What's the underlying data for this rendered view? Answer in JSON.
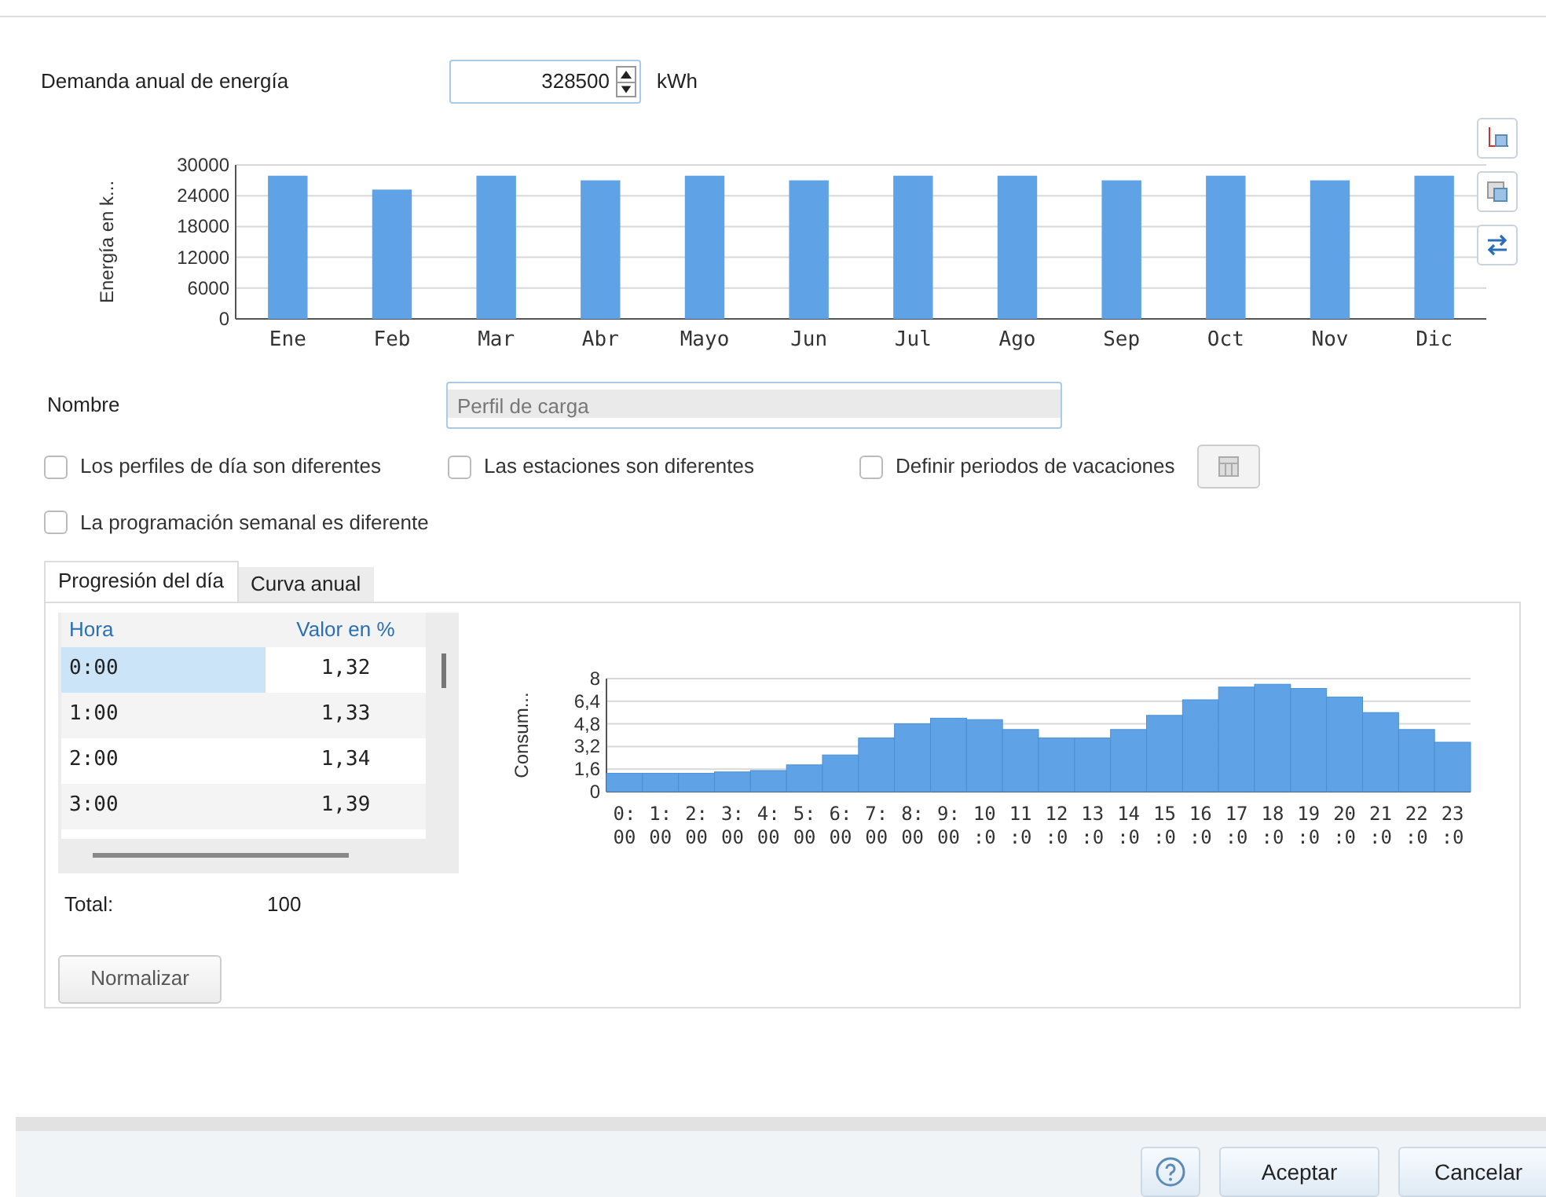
{
  "demand": {
    "label": "Demanda anual de energía",
    "value": "328500",
    "unit": "kWh"
  },
  "monthly_chart": {
    "chart_data": {
      "type": "bar",
      "ylabel": "Energía en k...",
      "categories": [
        "Ene",
        "Feb",
        "Mar",
        "Abr",
        "Mayo",
        "Jun",
        "Jul",
        "Ago",
        "Sep",
        "Oct",
        "Nov",
        "Dic"
      ],
      "grid": true,
      "series": [
        {
          "color": "#5fa3e6",
          "values": [
            27900,
            25200,
            27900,
            27000,
            27900,
            27000,
            27900,
            27900,
            27000,
            27900,
            27000,
            27900
          ]
        }
      ],
      "ylim": [
        0,
        30000
      ],
      "yticks": [
        0,
        6000,
        12000,
        18000,
        24000,
        30000
      ]
    }
  },
  "name_field": {
    "label": "Nombre",
    "placeholder": "Perfil de carga"
  },
  "options": [
    {
      "label": "Los perfiles de día son diferentes",
      "checked": false
    },
    {
      "label": "Las estaciones son diferentes",
      "checked": false
    },
    {
      "label": "Definir periodos de vacaciones",
      "checked": false
    },
    {
      "label": "La programación semanal es diferente",
      "checked": false
    }
  ],
  "tabs": [
    {
      "label": "Progresión del día",
      "selected": true
    },
    {
      "label": "Curva anual",
      "selected": false
    }
  ],
  "table": {
    "columns": [
      "Hora",
      "Valor en %"
    ],
    "rows": [
      {
        "cells": [
          "0:00",
          "1,32"
        ],
        "selected": true
      },
      {
        "cells": [
          "1:00",
          "1,33"
        ],
        "selected": false
      },
      {
        "cells": [
          "2:00",
          "1,34"
        ],
        "selected": false
      },
      {
        "cells": [
          "3:00",
          "1,39"
        ],
        "selected": false
      }
    ]
  },
  "total": {
    "label": "Total:",
    "value": "100"
  },
  "normalize_button": "Normalizar",
  "daily_chart": {
    "chart_data": {
      "type": "bar",
      "ylabel": "Consum...",
      "categories": [
        "0:00",
        "1:00",
        "2:00",
        "3:00",
        "4:00",
        "5:00",
        "6:00",
        "7:00",
        "8:00",
        "9:00",
        "10:0",
        "11:0",
        "12:0",
        "13:0",
        "14:0",
        "15:0",
        "16:0",
        "17:0",
        "18:0",
        "19:0",
        "20:0",
        "21:0",
        "22:0",
        "23:0"
      ],
      "grid": true,
      "series": [
        {
          "color": "#5fa3e6",
          "values": [
            1.3,
            1.3,
            1.3,
            1.4,
            1.5,
            1.9,
            2.6,
            3.8,
            4.8,
            5.2,
            5.1,
            4.4,
            3.8,
            3.8,
            4.4,
            5.4,
            6.5,
            7.4,
            7.6,
            7.3,
            6.7,
            5.6,
            4.4,
            3.5
          ]
        }
      ],
      "ylim": [
        0,
        8
      ],
      "yticks": [
        0,
        {
          "value": 1.6,
          "label": "1,6"
        },
        {
          "value": 3.2,
          "label": "3,2"
        },
        {
          "value": 4.8,
          "label": "4,8"
        },
        {
          "value": 6.4,
          "label": "6,4"
        },
        8
      ]
    }
  },
  "footer_buttons": [
    "Aceptar",
    "Cancelar"
  ]
}
